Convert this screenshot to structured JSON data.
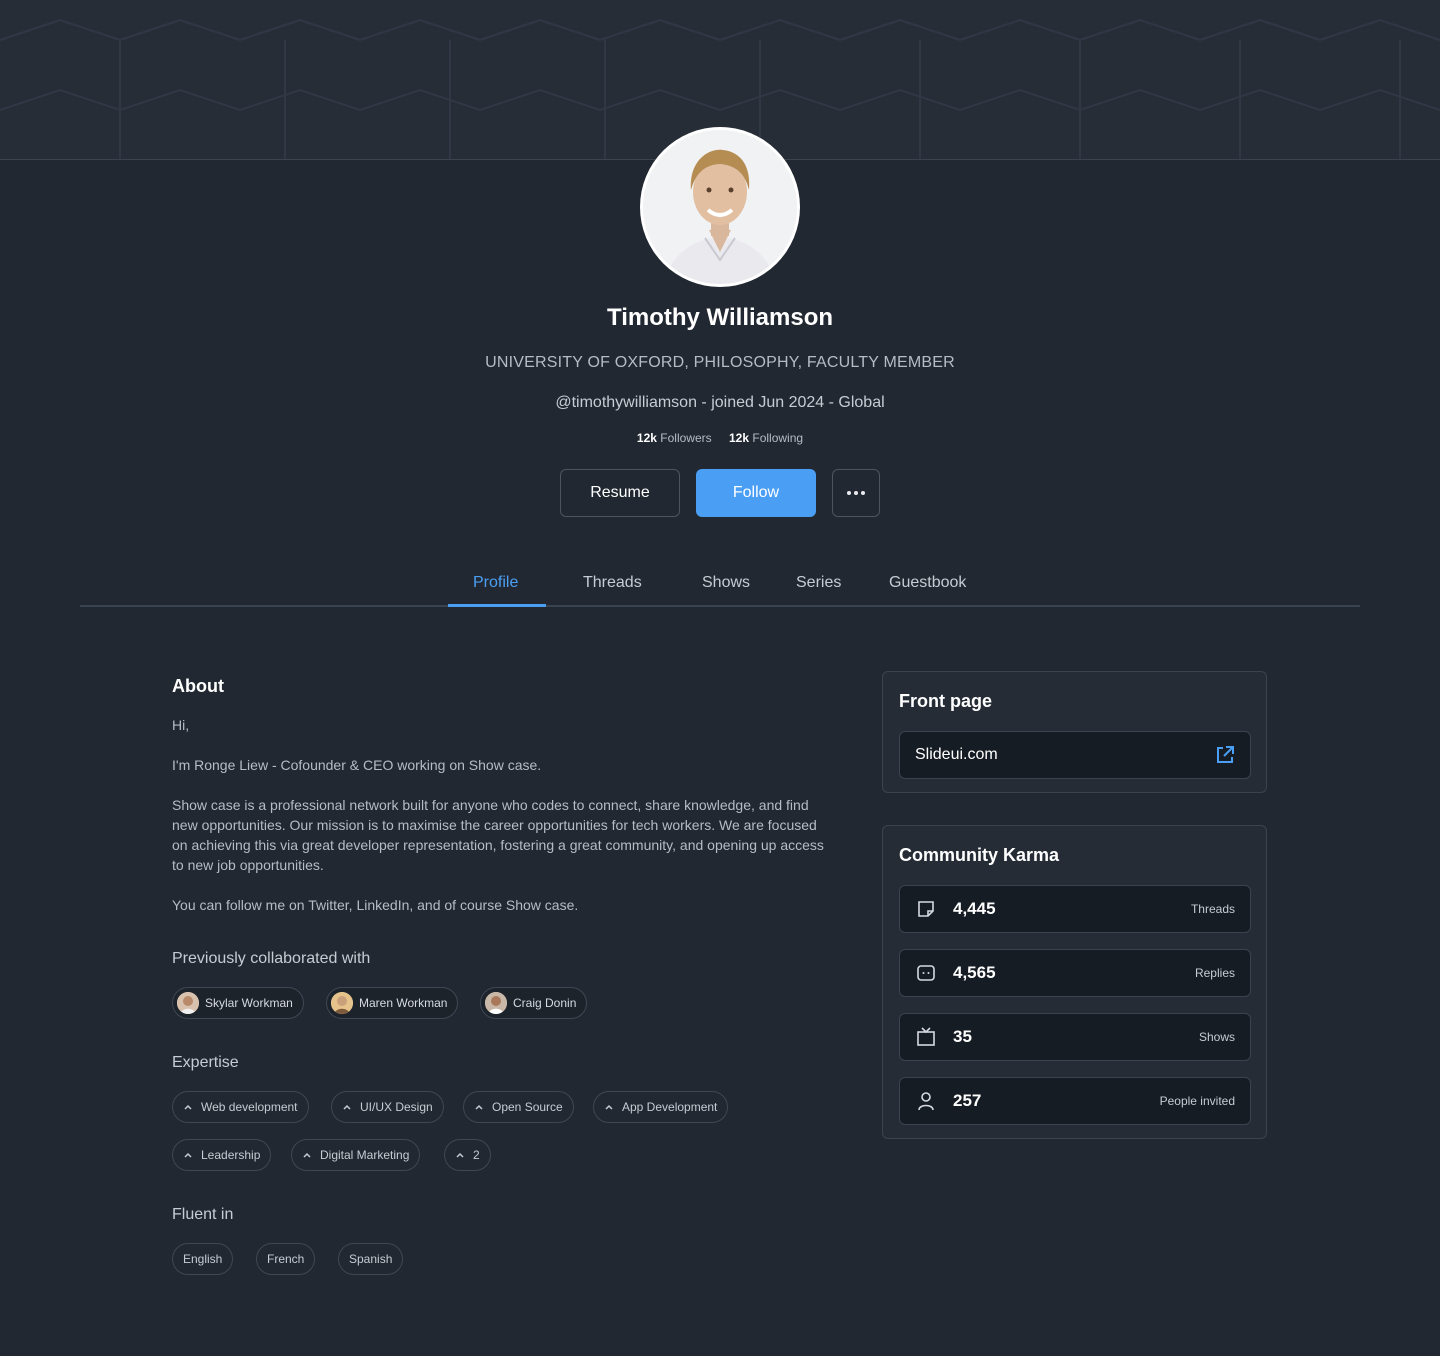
{
  "profile": {
    "name": "Timothy Williamson",
    "headline": "UNIVERSITY OF OXFORD, PHILOSOPHY, FACULTY MEMBER",
    "meta": "@timothywilliamson - joined Jun 2024 - Global",
    "followers_count": "12k",
    "followers_label": "Followers",
    "following_count": "12k",
    "following_label": "Following"
  },
  "actions": {
    "resume_label": "Resume",
    "follow_label": "Follow",
    "more_icon": "more-horizontal-icon"
  },
  "tabs": [
    {
      "label": "Profile",
      "active": true
    },
    {
      "label": "Threads",
      "active": false
    },
    {
      "label": "Shows",
      "active": false
    },
    {
      "label": "Series",
      "active": false
    },
    {
      "label": "Guestbook",
      "active": false
    }
  ],
  "about": {
    "title": "About",
    "paragraphs": [
      "Hi,",
      "I'm Ronge Liew - Cofounder & CEO working on Show case.",
      "Show case is a professional network built for anyone who codes to connect, share knowledge, and find new opportunities. Our mission is to maximise the career opportunities for tech workers. We are focused on achieving this via great developer representation, fostering a great community, and opening up access to new job opportunities.",
      "You can follow me on Twitter, LinkedIn, and of course Show case."
    ]
  },
  "collaborators": {
    "title": "Previously collaborated with",
    "items": [
      "Skylar Workman",
      "Maren Workman",
      "Craig Donin"
    ]
  },
  "expertise": {
    "title": "Expertise",
    "items": [
      "Web development",
      "UI/UX Design",
      "Open Source",
      "App Development",
      "Leadership",
      "Digital Marketing",
      "2"
    ]
  },
  "languages": {
    "title": "Fluent in",
    "items": [
      "English",
      "French",
      "Spanish"
    ]
  },
  "front_page": {
    "title": "Front page",
    "url": "Slideui.com",
    "icon": "external-link-icon"
  },
  "karma": {
    "title": "Community Karma",
    "rows": [
      {
        "value": "4,445",
        "label": "Threads",
        "icon": "thread-note-icon"
      },
      {
        "value": "4,565",
        "label": "Replies",
        "icon": "reply-bubble-icon"
      },
      {
        "value": "35",
        "label": "Shows",
        "icon": "tv-icon"
      },
      {
        "value": "257",
        "label": "People invited",
        "icon": "user-icon"
      }
    ]
  },
  "colors": {
    "accent": "#4a9ff5",
    "background": "#222831",
    "card": "#252c35",
    "input": "#161c24"
  }
}
